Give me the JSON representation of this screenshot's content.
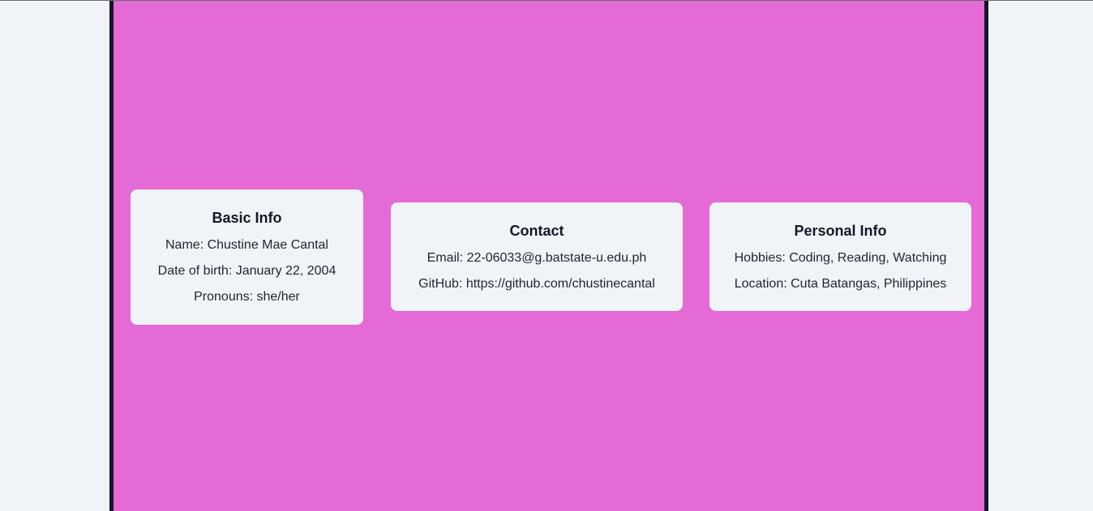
{
  "colors": {
    "page_background": "#f0f4f8",
    "panel_background": "#e46ad6",
    "panel_border": "#141826",
    "card_background": "#f0f4f8"
  },
  "basic_info": {
    "title": "Basic Info",
    "name": "Name: Chustine Mae Cantal",
    "dob": "Date of birth: January 22, 2004",
    "pronouns": "Pronouns: she/her"
  },
  "contact": {
    "title": "Contact",
    "email": "Email: 22-06033@g.batstate-u.edu.ph",
    "github": "GitHub: https://github.com/chustinecantal"
  },
  "personal_info": {
    "title": "Personal Info",
    "hobbies": "Hobbies: Coding, Reading, Watching",
    "location": "Location: Cuta Batangas, Philippines"
  }
}
